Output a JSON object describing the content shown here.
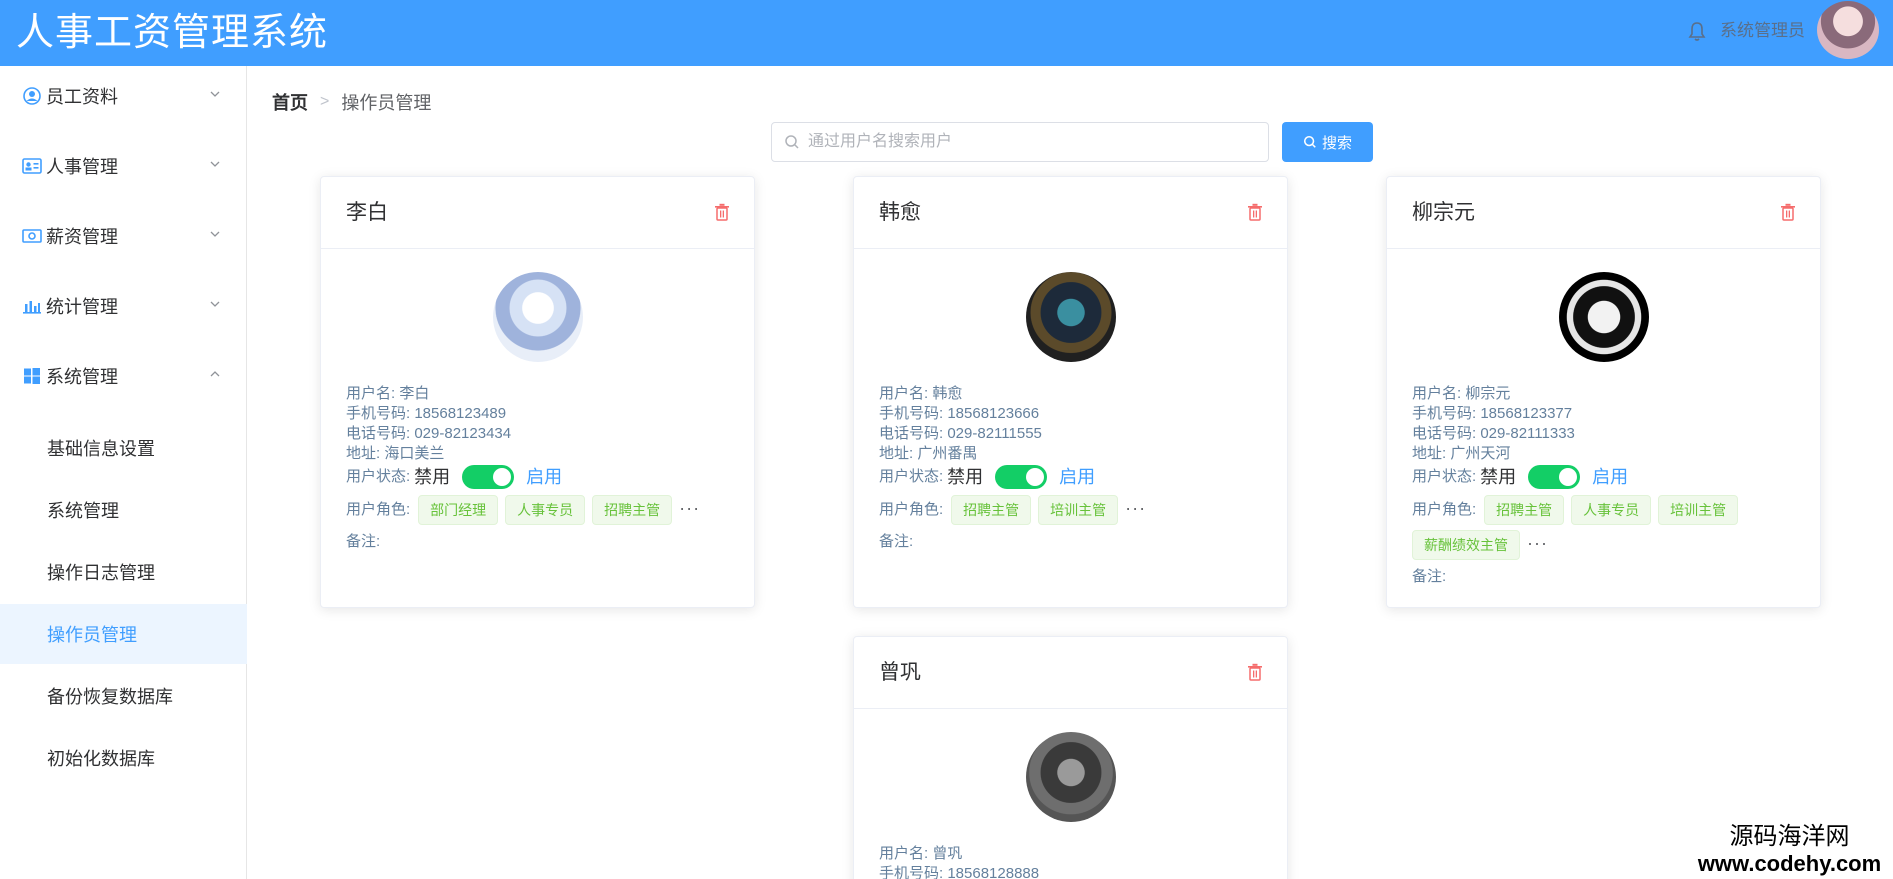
{
  "header": {
    "title": "人事工资管理系统",
    "user_name": "系统管理员"
  },
  "sidebar": {
    "menus": [
      {
        "label": "员工资料",
        "icon": "user-circle-icon"
      },
      {
        "label": "人事管理",
        "icon": "id-card-icon"
      },
      {
        "label": "薪资管理",
        "icon": "money-icon"
      },
      {
        "label": "统计管理",
        "icon": "bar-chart-icon"
      },
      {
        "label": "系统管理",
        "icon": "windows-icon"
      }
    ],
    "sub_items": [
      "基础信息设置",
      "系统管理",
      "操作日志管理",
      "操作员管理",
      "备份恢复数据库",
      "初始化数据库"
    ],
    "active_sub": "操作员管理"
  },
  "breadcrumb": {
    "home": "首页",
    "current": "操作员管理"
  },
  "search": {
    "placeholder": "通过用户名搜索用户",
    "button_label": "搜索"
  },
  "labels": {
    "username": "用户名:",
    "phone": "手机号码:",
    "telephone": "电话号码:",
    "address": "地址:",
    "status": "用户状态:",
    "disabled": "禁用",
    "enabled": "启用",
    "roles": "用户角色:",
    "remark": "备注:"
  },
  "cards": [
    {
      "name": "李白",
      "username": "李白",
      "phone": "18568123489",
      "telephone": "029-82123434",
      "address": "海口美兰",
      "enabled": true,
      "roles": [
        "部门经理",
        "人事专员",
        "招聘主管"
      ]
    },
    {
      "name": "韩愈",
      "username": "韩愈",
      "phone": "18568123666",
      "telephone": "029-82111555",
      "address": "广州番禺",
      "enabled": true,
      "roles": [
        "招聘主管",
        "培训主管"
      ]
    },
    {
      "name": "柳宗元",
      "username": "柳宗元",
      "phone": "18568123377",
      "telephone": "029-82111333",
      "address": "广州天河",
      "enabled": true,
      "roles": [
        "招聘主管",
        "人事专员",
        "培训主管",
        "薪酬绩效主管"
      ]
    },
    {
      "name": "曾巩",
      "username": "曾巩",
      "phone": "18568128888",
      "telephone": "",
      "address": "",
      "enabled": true,
      "roles": []
    }
  ],
  "watermark": {
    "line1": "源码海洋网",
    "line2": "www.codehy.com"
  },
  "colors": {
    "primary": "#409eff",
    "switch_on": "#13ce66",
    "tag_green": "#67c23a"
  }
}
